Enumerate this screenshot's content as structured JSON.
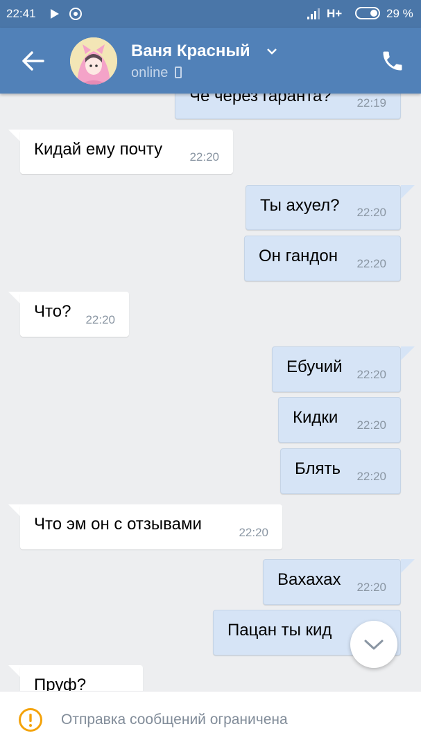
{
  "status_bar": {
    "time": "22:41",
    "network": "H+",
    "battery": "29 %"
  },
  "header": {
    "contact_name": "Ваня Красный",
    "status": "online",
    "icons": [
      "back-arrow-icon",
      "chevron-down-icon",
      "mobile-icon",
      "phone-icon"
    ]
  },
  "messages": [
    {
      "side": "out",
      "text": "Че через гаранта?",
      "time": "22:19"
    },
    {
      "side": "in",
      "text": "Кидай ему почту",
      "time": "22:20"
    },
    {
      "side": "out",
      "text": "Ты ахуел?",
      "time": "22:20"
    },
    {
      "side": "out",
      "text": "Он гандон",
      "time": "22:20"
    },
    {
      "side": "in",
      "text": "Что?",
      "time": "22:20"
    },
    {
      "side": "out",
      "text": "Ебучий",
      "time": "22:20"
    },
    {
      "side": "out",
      "text": "Кидки",
      "time": "22:20"
    },
    {
      "side": "out",
      "text": "Блять",
      "time": "22:20"
    },
    {
      "side": "in",
      "text": "Что эм он с отзывами",
      "time": "22:20"
    },
    {
      "side": "out",
      "text": "Вахахах",
      "time": "22:20"
    },
    {
      "side": "out",
      "text": "Пацан ты кид",
      "time": ""
    },
    {
      "side": "in",
      "text": "Пруф?",
      "time": ""
    }
  ],
  "bottom_bar": {
    "notice": "Отправка сообщений ограничена",
    "icon": "warning-icon"
  },
  "colors": {
    "header": "#5181b8",
    "statusbar": "#4a76a8",
    "outgoing": "#d6e4f6",
    "incoming": "#ffffff",
    "warning": "#f4a30b"
  }
}
